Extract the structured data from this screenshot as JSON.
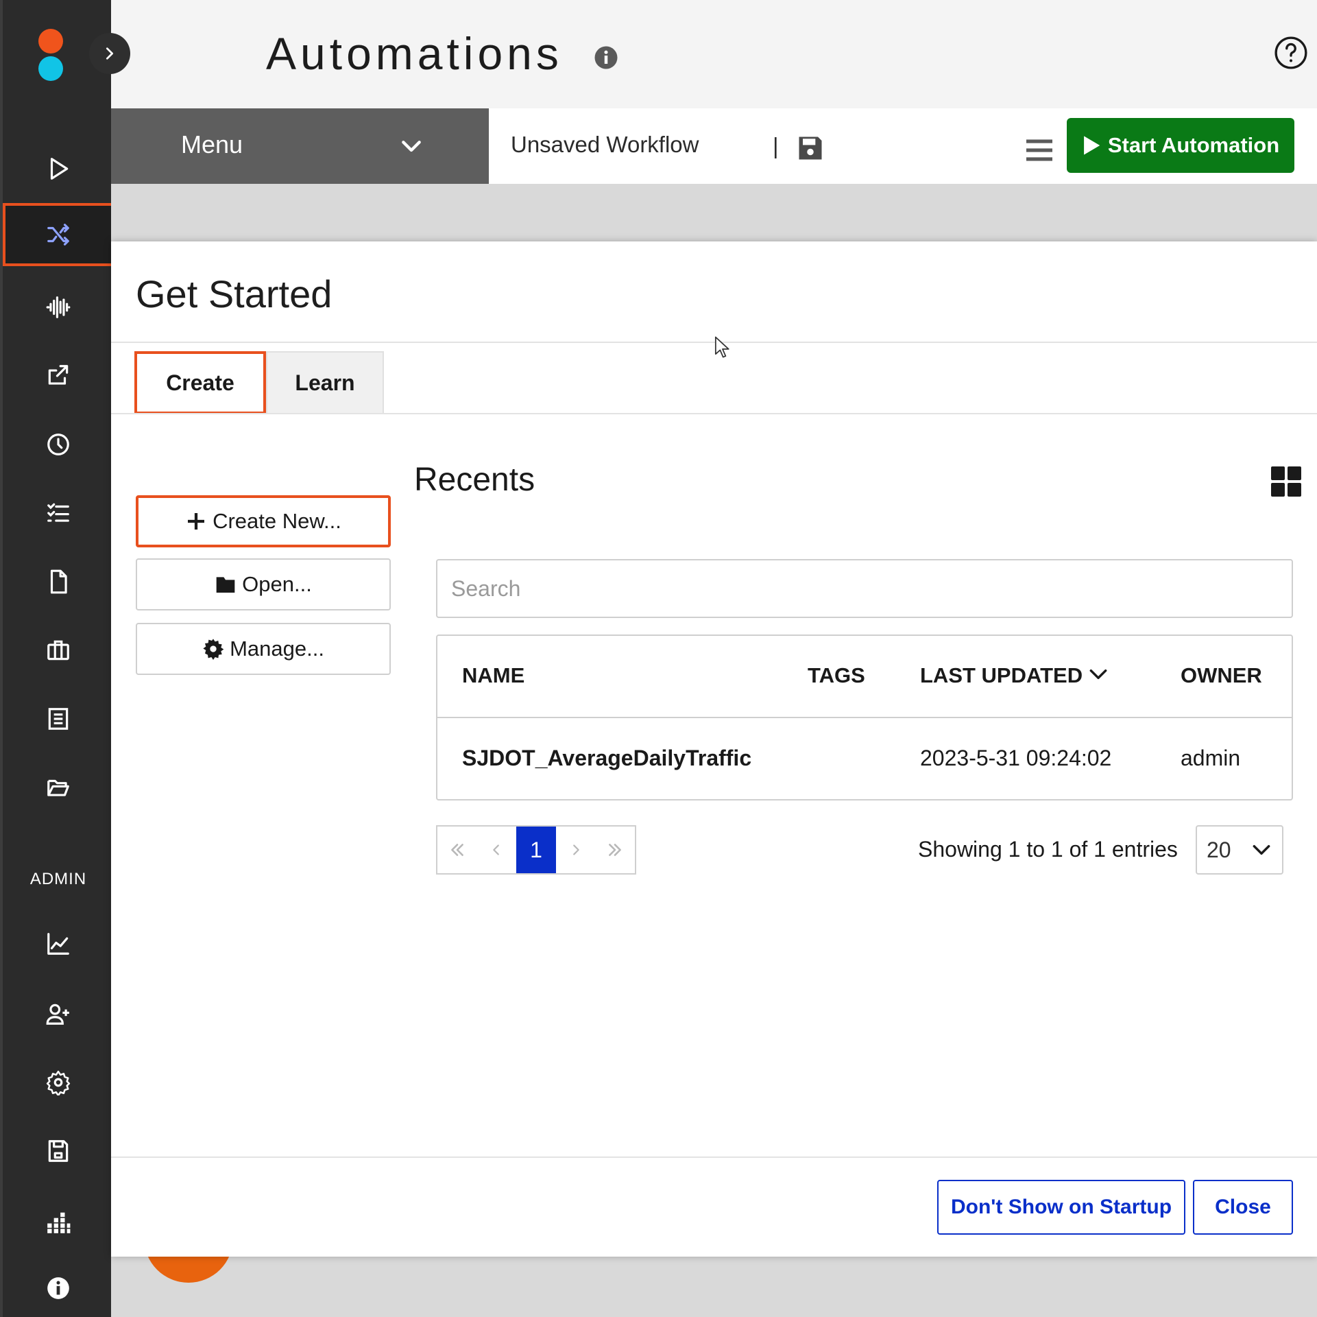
{
  "colors": {
    "rail_bg": "#2b2b2b",
    "accent_orange": "#e8501e",
    "start_green": "#0a7a16",
    "primary_blue": "#0a2fc9",
    "logo_orange": "#f0541c",
    "logo_cyan": "#11c4e6",
    "rail_icon_active": "#8ea2ff"
  },
  "header": {
    "title": "Automations",
    "icons": [
      "info-icon",
      "help-icon",
      "user-icon"
    ]
  },
  "sidebar": {
    "items": [
      {
        "icon": "play-icon"
      },
      {
        "icon": "shuffle-icon",
        "active": true
      },
      {
        "icon": "waveform-icon"
      },
      {
        "icon": "share-icon"
      },
      {
        "icon": "clock-icon"
      },
      {
        "icon": "checklist-icon"
      },
      {
        "icon": "document-icon"
      },
      {
        "icon": "briefcase-icon"
      },
      {
        "icon": "form-icon"
      },
      {
        "icon": "folder-open-icon"
      }
    ],
    "admin_label": "ADMIN",
    "admin_items": [
      {
        "icon": "chart-icon"
      },
      {
        "icon": "add-user-icon"
      },
      {
        "icon": "settings-icon"
      },
      {
        "icon": "save-icon"
      },
      {
        "icon": "grid-chart-icon"
      },
      {
        "icon": "info-icon"
      }
    ]
  },
  "toolbar": {
    "menu_label": "Menu",
    "workflow_name": "Unsaved Workflow",
    "separator": "|",
    "start_label": "Start Automation"
  },
  "modal": {
    "title": "Get Started",
    "tabs": [
      {
        "label": "Create",
        "active": true
      },
      {
        "label": "Learn",
        "active": false
      }
    ],
    "actions": {
      "create_new": "Create New...",
      "open": "Open...",
      "manage": "Manage..."
    },
    "recents": {
      "title": "Recents",
      "search_placeholder": "Search",
      "columns": [
        "NAME",
        "TAGS",
        "LAST UPDATED",
        "OWNER"
      ],
      "rows": [
        {
          "name": "SJDOT_AverageDailyTraffic",
          "tags": "",
          "last_updated": "2023-5-31 09:24:02",
          "owner": "admin"
        }
      ],
      "pagination": {
        "current_page": "1",
        "info": "Showing 1 to 1 of 1 entries",
        "page_size": "20"
      }
    },
    "footer": {
      "dont_show": "Don't Show on Startup",
      "close": "Close"
    }
  }
}
